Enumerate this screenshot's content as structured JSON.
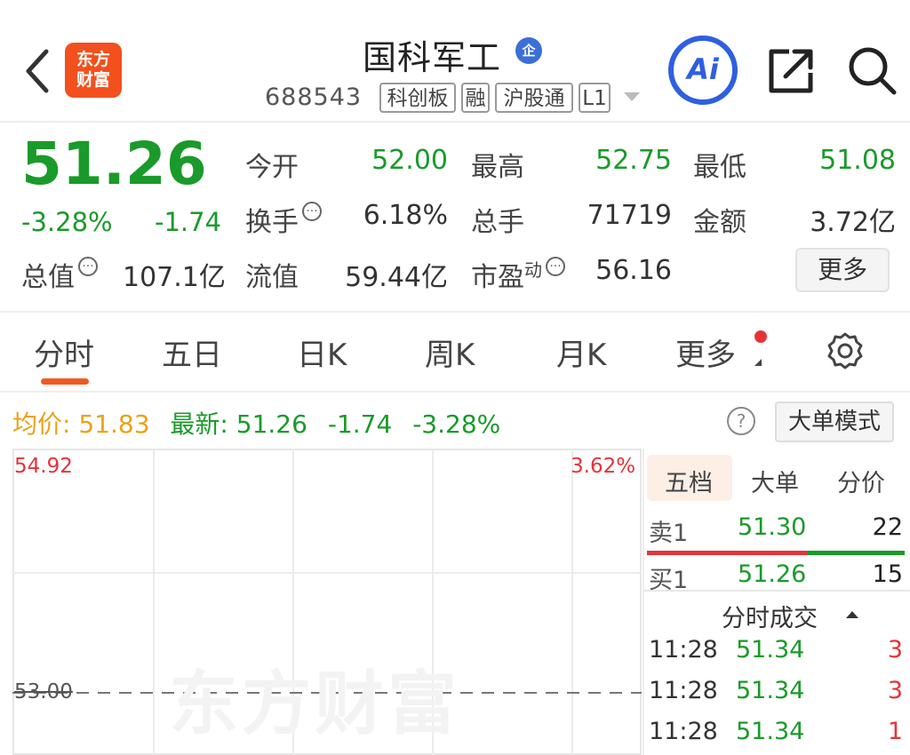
{
  "colors": {
    "up": "#e5333a",
    "down": "#1a9a2a",
    "accent": "#f05a22",
    "avg": "#e8a317",
    "ai": "#2f5fe0"
  },
  "header": {
    "back_icon": "chevron-left-icon",
    "logo_lines": [
      "东方",
      "财富"
    ],
    "title": "国科军工",
    "badge": "企",
    "code": "688543",
    "tags": [
      "科创板",
      "融",
      "沪股通",
      "L1"
    ],
    "ai_label": "Ai",
    "share_icon": "share-icon",
    "search_icon": "search-icon"
  },
  "quote": {
    "price": "51.26",
    "change_pct": "-3.28%",
    "change": "-1.74",
    "open_label": "今开",
    "open": "52.00",
    "high_label": "最高",
    "high": "52.75",
    "low_label": "最低",
    "low": "51.08",
    "turnover_label": "换手",
    "turnover": "6.18%",
    "volume_label": "总手",
    "volume": "71719",
    "amount_label": "金额",
    "amount": "3.72亿",
    "mktcap_label": "总值",
    "mktcap": "107.1亿",
    "float_label": "流值",
    "float_cap": "59.44亿",
    "pe_label": "市盈",
    "pe_sup": "动",
    "pe": "56.16",
    "more_label": "更多"
  },
  "tabs": [
    "分时",
    "五日",
    "日K",
    "周K",
    "月K",
    "更多"
  ],
  "info_line": {
    "avg_label": "均价:",
    "avg": "51.83",
    "latest_label": "最新:",
    "latest": "51.26",
    "change": "-1.74",
    "change_pct": "-3.28%",
    "mode_label": "大单模式"
  },
  "chart": {
    "hi": "54.92",
    "hi_pct": "3.62%",
    "mid": "53.00",
    "watermark": "东方财富"
  },
  "panel": {
    "tabs": [
      "五档",
      "大单",
      "分价"
    ],
    "sell1": {
      "label": "卖1",
      "price": "51.30",
      "qty": "22"
    },
    "buy1": {
      "label": "买1",
      "price": "51.26",
      "qty": "15"
    },
    "ticks_header": "分时成交",
    "ticks": [
      {
        "time": "11:28",
        "price": "51.34",
        "qty": "3"
      },
      {
        "time": "11:28",
        "price": "51.34",
        "qty": "3"
      },
      {
        "time": "11:28",
        "price": "51.34",
        "qty": "1"
      }
    ]
  }
}
